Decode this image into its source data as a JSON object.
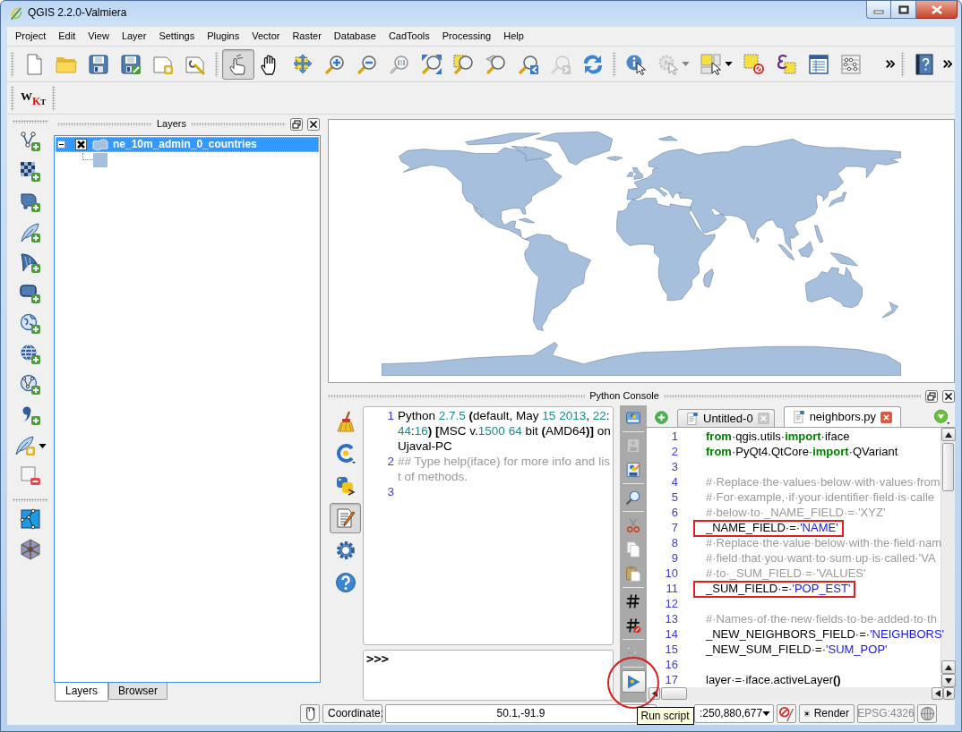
{
  "window": {
    "title": "QGIS 2.2.0-Valmiera"
  },
  "menu": [
    "Project",
    "Edit",
    "View",
    "Layer",
    "Settings",
    "Plugins",
    "Vector",
    "Raster",
    "Database",
    "CadTools",
    "Processing",
    "Help"
  ],
  "toolbar": [
    [
      {
        "kind": "new",
        "selected": false,
        "disabled": false
      },
      {
        "kind": "open",
        "selected": false,
        "disabled": false
      },
      {
        "kind": "save",
        "selected": false,
        "disabled": false
      },
      {
        "kind": "saveas",
        "selected": false,
        "disabled": false
      },
      {
        "kind": "composer",
        "selected": false,
        "disabled": false
      },
      {
        "kind": "manager",
        "selected": false,
        "disabled": false
      }
    ],
    [
      {
        "kind": "touch",
        "selected": true,
        "disabled": false
      },
      {
        "kind": "pan",
        "selected": false,
        "disabled": false
      },
      {
        "kind": "panselection",
        "selected": false,
        "disabled": false
      },
      {
        "kind": "zoomin",
        "selected": false,
        "disabled": false
      },
      {
        "kind": "zoomout",
        "selected": false,
        "disabled": false
      },
      {
        "kind": "zoomnative",
        "selected": false,
        "disabled": false
      },
      {
        "kind": "zoomfull",
        "selected": false,
        "disabled": false
      },
      {
        "kind": "zoomselection",
        "selected": false,
        "disabled": false
      },
      {
        "kind": "zoomlayer",
        "selected": false,
        "disabled": false
      },
      {
        "kind": "zoomlast",
        "selected": false,
        "disabled": false
      },
      {
        "kind": "zoomnext",
        "selected": false,
        "disabled": true
      },
      {
        "kind": "refresh",
        "selected": false,
        "disabled": false
      }
    ],
    [
      {
        "kind": "identify",
        "selected": false,
        "disabled": false
      },
      {
        "kind": "action",
        "selected": false,
        "disabled": true
      },
      {
        "kind": "select",
        "selected": false,
        "disabled": false
      },
      {
        "kind": "deselect",
        "selected": false,
        "disabled": false
      },
      {
        "kind": "expression",
        "selected": false,
        "disabled": false
      },
      {
        "kind": "table",
        "selected": false,
        "disabled": false
      },
      {
        "kind": "calculator",
        "selected": false,
        "disabled": false
      },
      {
        "kind": "more",
        "selected": false,
        "disabled": false
      }
    ],
    [
      {
        "kind": "help",
        "selected": false,
        "disabled": false
      },
      {
        "kind": "more",
        "selected": false,
        "disabled": false
      }
    ]
  ],
  "wkt_button": {
    "letters": [
      "W",
      "K",
      "T"
    ]
  },
  "layer_toolbar": [
    [
      {
        "kind": "addvector"
      },
      {
        "kind": "addraster"
      },
      {
        "kind": "postgis"
      },
      {
        "kind": "spatialite"
      },
      {
        "kind": "mssql"
      },
      {
        "kind": "oracle"
      },
      {
        "kind": "wms"
      },
      {
        "kind": "wcs"
      },
      {
        "kind": "wfs"
      },
      {
        "kind": "delimited"
      },
      {
        "kind": "newlayer"
      },
      {
        "kind": "remove"
      }
    ],
    [
      {
        "kind": "topology"
      },
      {
        "kind": "plugin"
      }
    ]
  ],
  "layers_panel": {
    "title": "Layers",
    "layers": [
      {
        "name": "ne_10m_admin_0_countries",
        "visible": true,
        "selected": true,
        "expanded": true,
        "color": "#a5bfdd"
      }
    ],
    "tabs": [
      {
        "label": "Layers",
        "selected": true
      },
      {
        "label": "Browser",
        "selected": false
      }
    ]
  },
  "python_console": {
    "title": "Python Console",
    "toolbar": [
      {
        "kind": "clear",
        "selected": false
      },
      {
        "kind": "classes",
        "selected": false
      },
      {
        "kind": "run",
        "selected": false
      },
      {
        "kind": "editor",
        "selected": true
      },
      {
        "kind": "settings",
        "selected": false
      },
      {
        "kind": "help",
        "selected": false
      }
    ],
    "output": [
      {
        "number": "1",
        "segments": [
          {
            "text": "Python ",
            "kind": "plain"
          },
          {
            "text": "2.7.5 ",
            "kind": "number"
          },
          {
            "text": "(",
            "kind": "op"
          },
          {
            "text": "default, May ",
            "kind": "plain"
          },
          {
            "text": "15 ",
            "kind": "number"
          },
          {
            "text": "2013",
            "kind": "number"
          },
          {
            "text": ", ",
            "kind": "plain"
          },
          {
            "text": "22",
            "kind": "number"
          },
          {
            "text": ":",
            "kind": "plain"
          },
          {
            "text": "44",
            "kind": "number"
          },
          {
            "text": ":",
            "kind": "plain"
          },
          {
            "text": "16",
            "kind": "number"
          },
          {
            "text": ") [",
            "kind": "op"
          },
          {
            "text": "MSC v.",
            "kind": "plain"
          },
          {
            "text": "1500 ",
            "kind": "number"
          },
          {
            "text": "64",
            "kind": "number"
          },
          {
            "text": " bit ",
            "kind": "plain"
          },
          {
            "text": "(",
            "kind": "op"
          },
          {
            "text": "AMD64",
            "kind": "plain"
          },
          {
            "text": ")]",
            "kind": "op"
          },
          {
            "text": " on Ujaval-PC",
            "kind": "plain"
          }
        ]
      },
      {
        "number": "2",
        "segments": [
          {
            "text": "## Type help(iface) for more info and list of methods.",
            "kind": "comment"
          }
        ]
      },
      {
        "number": "3"
      }
    ],
    "input": {
      "prompt": ">>>"
    },
    "editor": {
      "toolbar": [
        [
          {
            "kind": "open",
            "disabled": false,
            "circled": false
          }
        ],
        [
          {
            "kind": "save",
            "disabled": true,
            "circled": false
          },
          {
            "kind": "saveas",
            "disabled": false,
            "circled": false
          }
        ],
        [
          {
            "kind": "find",
            "disabled": false,
            "circled": false
          }
        ],
        [
          {
            "kind": "cut",
            "disabled": false,
            "circled": false
          },
          {
            "kind": "copy",
            "disabled": false,
            "circled": false
          },
          {
            "kind": "paste",
            "disabled": false,
            "circled": false
          }
        ],
        [
          {
            "kind": "comment",
            "disabled": false,
            "circled": false
          },
          {
            "kind": "uncomment",
            "disabled": false,
            "circled": false
          }
        ],
        [
          {
            "kind": "inspector",
            "disabled": true,
            "circled": false
          }
        ],
        [
          {
            "kind": "run",
            "disabled": false,
            "circled": true,
            "tooltip": "Run script"
          }
        ]
      ],
      "tabs": [
        {
          "label": "Untitled-0",
          "selected": false
        },
        {
          "label": "neighbors.py",
          "selected": true
        }
      ],
      "lines": [
        {
          "number": "1",
          "highlighted": false,
          "segments": [
            {
              "text": "from",
              "kind": "keyword"
            },
            {
              "text": "·qgis.utils·",
              "kind": "plain"
            },
            {
              "text": "import",
              "kind": "keyword"
            },
            {
              "text": "·iface",
              "kind": "plain"
            }
          ]
        },
        {
          "number": "2",
          "highlighted": false,
          "segments": [
            {
              "text": "from",
              "kind": "keyword"
            },
            {
              "text": "·PyQt4.QtCore·",
              "kind": "plain"
            },
            {
              "text": "import",
              "kind": "keyword"
            },
            {
              "text": "·QVariant",
              "kind": "plain"
            }
          ]
        },
        {
          "number": "3",
          "highlighted": false
        },
        {
          "number": "4",
          "highlighted": false,
          "segments": [
            {
              "text": "#·Replace·the·values·below·with·values·from",
              "kind": "comment"
            }
          ]
        },
        {
          "number": "5",
          "highlighted": false,
          "segments": [
            {
              "text": "#·For·example,·if·your·identifier·field·is·calle",
              "kind": "comment"
            }
          ]
        },
        {
          "number": "6",
          "highlighted": false,
          "segments": [
            {
              "text": "#·below·to·_NAME_FIELD·=·'XYZ'",
              "kind": "comment"
            }
          ]
        },
        {
          "number": "7",
          "highlighted": true,
          "segments": [
            {
              "text": "_NAME_FIELD·=·",
              "kind": "plain"
            },
            {
              "text": "'NAME'",
              "kind": "string"
            }
          ]
        },
        {
          "number": "8",
          "highlighted": false,
          "segments": [
            {
              "text": "#·Replace·the·value·below·with·the·field·nam",
              "kind": "comment"
            }
          ]
        },
        {
          "number": "9",
          "highlighted": false,
          "segments": [
            {
              "text": "#·field·that·you·want·to·sum·up·is·called·'VA",
              "kind": "comment"
            }
          ]
        },
        {
          "number": "10",
          "highlighted": false,
          "segments": [
            {
              "text": "#·to·_SUM_FIELD·=·'VALUES'",
              "kind": "comment"
            }
          ]
        },
        {
          "number": "11",
          "highlighted": true,
          "segments": [
            {
              "text": "_SUM_FIELD·=·",
              "kind": "plain"
            },
            {
              "text": "'POP_EST'",
              "kind": "string"
            }
          ]
        },
        {
          "number": "12",
          "highlighted": false
        },
        {
          "number": "13",
          "highlighted": false,
          "segments": [
            {
              "text": "#·Names·of·the·new·fields·to·be·added·to·th",
              "kind": "comment"
            }
          ]
        },
        {
          "number": "14",
          "highlighted": false,
          "segments": [
            {
              "text": "_NEW_NEIGHBORS_FIELD·=·",
              "kind": "plain"
            },
            {
              "text": "'NEIGHBORS'",
              "kind": "string"
            }
          ]
        },
        {
          "number": "15",
          "highlighted": false,
          "segments": [
            {
              "text": "_NEW_SUM_FIELD·=·",
              "kind": "plain"
            },
            {
              "text": "'SUM_POP'",
              "kind": "string"
            }
          ]
        },
        {
          "number": "16",
          "highlighted": false
        },
        {
          "number": "17",
          "highlighted": false,
          "segments": [
            {
              "text": "layer·=·iface.activeLayer",
              "kind": "plain"
            },
            {
              "text": "()",
              "kind": "op"
            }
          ]
        }
      ]
    }
  },
  "status_bar": {
    "coordinate_label": "Coordinate:",
    "coordinate": "50.1,-91.9",
    "scale": ":250,880,677",
    "render": {
      "label": "Render",
      "checked": true
    },
    "crs": {
      "label": "EPSG:4326",
      "disabled": true
    }
  }
}
